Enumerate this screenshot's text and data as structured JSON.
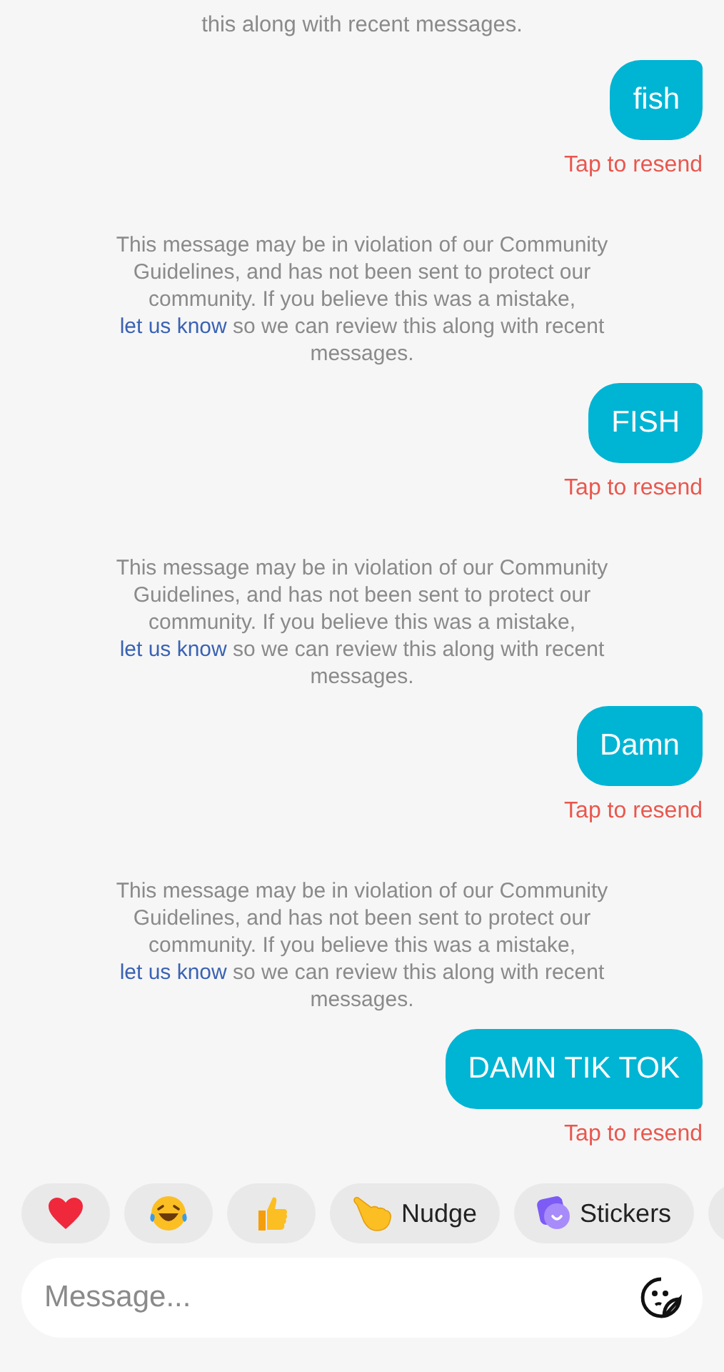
{
  "messages": [
    {
      "kind": "notice_tail",
      "text": "this along with recent messages."
    },
    {
      "kind": "sent",
      "text": "fish",
      "status": "Tap to resend"
    },
    {
      "kind": "notice",
      "before": "This message may be in violation of our Community Guidelines, and has not been sent to protect our community. If you believe this was a mistake,",
      "link": "let us know",
      "after": "so we can review this along with recent messages."
    },
    {
      "kind": "sent",
      "text": "FISH",
      "status": "Tap to resend"
    },
    {
      "kind": "notice",
      "before": "This message may be in violation of our Community Guidelines, and has not been sent to protect our community. If you believe this was a mistake,",
      "link": "let us know",
      "after": "so we can review this along with recent messages."
    },
    {
      "kind": "sent",
      "text": "Damn",
      "status": "Tap to resend"
    },
    {
      "kind": "notice",
      "before": "This message may be in violation of our Community Guidelines, and has not been sent to protect our community. If you believe this was a mistake,",
      "link": "let us know",
      "after": "so we can review this along with recent messages."
    },
    {
      "kind": "sent",
      "text": "DAMN TIK TOK",
      "status": "Tap to resend"
    }
  ],
  "quick_replies": [
    {
      "kind": "icon"
    },
    {
      "kind": "icon"
    },
    {
      "kind": "icon"
    },
    {
      "kind": "labeled",
      "label": "Nudge"
    },
    {
      "kind": "labeled",
      "label": "Stickers"
    }
  ],
  "composer": {
    "placeholder": "Message..."
  }
}
